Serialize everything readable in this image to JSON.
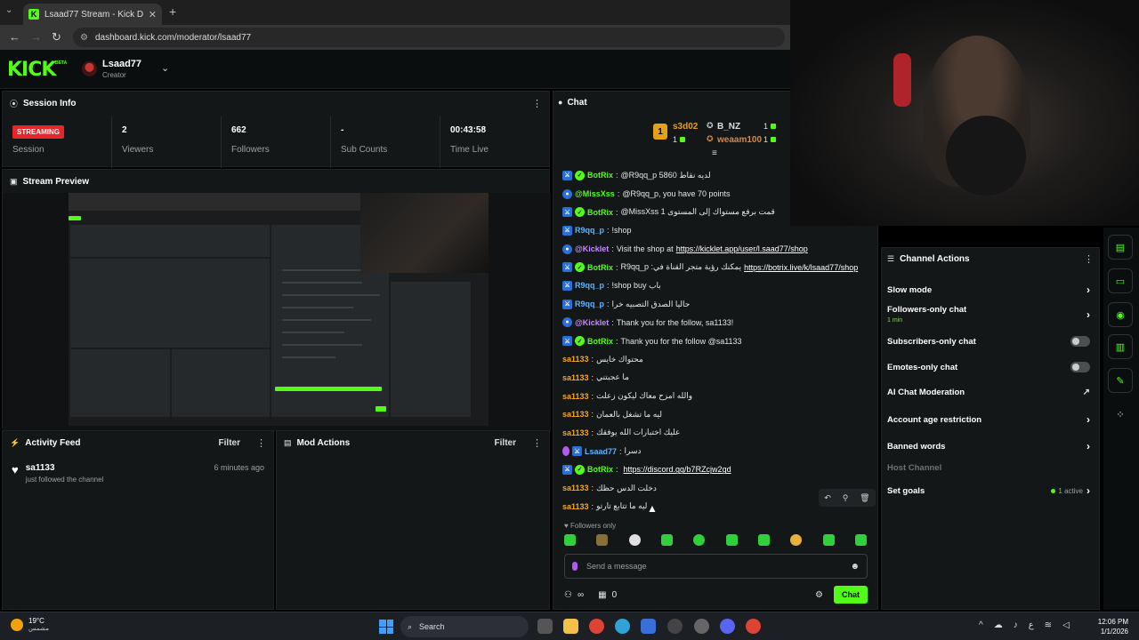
{
  "browser": {
    "tab_title": "Lsaad77 Stream - Kick Dashboard",
    "url": "dashboard.kick.com/moderator/lsaad77"
  },
  "header": {
    "logo": "KICK",
    "beta": "BETA",
    "channel_name": "Lsaad77",
    "channel_role": "Creator"
  },
  "session": {
    "title": "Session Info",
    "status_badge": "STREAMING",
    "session_label": "Session",
    "stats": [
      {
        "value": "2",
        "label": "Viewers"
      },
      {
        "value": "662",
        "label": "Followers"
      },
      {
        "value": "-",
        "label": "Sub Counts"
      },
      {
        "value": "00:43:58",
        "label": "Time Live"
      }
    ]
  },
  "preview": {
    "title": "Stream Preview"
  },
  "activity": {
    "title": "Activity Feed",
    "filter": "Filter",
    "items": [
      {
        "user": "sa1133",
        "desc": "just followed the channel",
        "time": "6 minutes ago"
      }
    ]
  },
  "mod_actions": {
    "title": "Mod Actions",
    "filter": "Filter"
  },
  "chat": {
    "title": "Chat",
    "leaderboard": [
      {
        "name": "s3d02",
        "count": "1"
      },
      {
        "name": "B_NZ",
        "count": "1"
      },
      {
        "name": "weaam100",
        "count": "1"
      }
    ],
    "leader_medal": "1",
    "messages": [
      {
        "badges": [
          "mod",
          "verified"
        ],
        "user": "BotRix",
        "color": "#53fc18",
        "text": "@R9qq_p 5860 لديه نقاط"
      },
      {
        "badges": [
          "bot"
        ],
        "user": "@MissXss",
        "color": "#53fc18",
        "text": "@R9qq_p, you have 70 points"
      },
      {
        "badges": [
          "mod",
          "verified"
        ],
        "user": "BotRix",
        "color": "#53fc18",
        "text": "@MissXss 1 قمت برفع مستواك إلى المستوى"
      },
      {
        "badges": [
          "mod"
        ],
        "user": "R9qq_p",
        "color": "#5ab4ff",
        "text": "!shop"
      },
      {
        "badges": [
          "bot"
        ],
        "user": "@Kicklet",
        "color": "#c48bff",
        "text": "Visit the shop at ",
        "link": "https://kicklet.app/user/l.saad77/shop"
      },
      {
        "badges": [
          "mod",
          "verified"
        ],
        "user": "BotRix",
        "color": "#53fc18",
        "text": "R9qq_p :يمكنك رؤية متجر القناة في ",
        "link": "https://botrix.live/k/lsaad77/shop"
      },
      {
        "badges": [
          "mod"
        ],
        "user": "R9qq_p",
        "color": "#5ab4ff",
        "text": "!shop buy باب"
      },
      {
        "badges": [
          "mod"
        ],
        "user": "R9qq_p",
        "color": "#5ab4ff",
        "text": "حاليا الصدق التصبيه خرا"
      },
      {
        "badges": [
          "bot"
        ],
        "user": "@Kicklet",
        "color": "#c48bff",
        "text": "Thank you for the follow, sa1133!"
      },
      {
        "badges": [
          "mod",
          "verified"
        ],
        "user": "BotRix",
        "color": "#53fc18",
        "text": "Thank you for the follow @sa1133"
      },
      {
        "badges": [],
        "user": "sa1133",
        "color": "#f5a623",
        "text": "محتواك خايس"
      },
      {
        "badges": [],
        "user": "sa1133",
        "color": "#f5a623",
        "text": "ما عجبتني"
      },
      {
        "badges": [],
        "user": "sa1133",
        "color": "#f5a623",
        "text": "والله امزح معاك ليكون زعلت"
      },
      {
        "badges": [],
        "user": "sa1133",
        "color": "#f5a623",
        "text": "ليه ما تشغل بالعمان"
      },
      {
        "badges": [],
        "user": "sa1133",
        "color": "#f5a623",
        "text": "عليك اختبارات الله يوفقك"
      },
      {
        "badges": [
          "broadcaster",
          "mod"
        ],
        "user": "Lsaad77",
        "color": "#5ab4ff",
        "text": "دسرا"
      },
      {
        "badges": [
          "mod",
          "verified"
        ],
        "user": "BotRix",
        "color": "#53fc18",
        "text": "",
        "link": "https://discord.gg/b7RZcjw2gd"
      },
      {
        "badges": [],
        "user": "sa1133",
        "color": "#f5a623",
        "text": "دخلت الدس حظك"
      },
      {
        "badges": [],
        "user": "sa1133",
        "color": "#f5a623",
        "text": "ليه ما تتابع تارتو"
      }
    ],
    "followers_only": "Followers only",
    "input_placeholder": "Send a message",
    "footer_infinity": "∞",
    "footer_count": "0",
    "send_label": "Chat"
  },
  "channel_actions": {
    "title": "Channel Actions",
    "items": [
      {
        "label": "Slow mode",
        "control": "chevron"
      },
      {
        "label": "Followers-only chat",
        "sub": "1 min",
        "control": "chevron"
      },
      {
        "label": "Subscribers-only chat",
        "control": "toggle"
      },
      {
        "label": "Emotes-only chat",
        "control": "toggle"
      },
      {
        "label": "AI Chat Moderation",
        "control": "external"
      },
      {
        "label": "Account age restriction",
        "control": "chevron"
      },
      {
        "label": "Banned words",
        "control": "chevron"
      },
      {
        "label": "Host Channel",
        "control": "disabled"
      },
      {
        "label": "Set goals",
        "control": "chevron",
        "active": "1 active"
      }
    ]
  },
  "taskbar": {
    "temp": "19°C",
    "weather": "مشمس",
    "search": "Search",
    "time": "12:06 PM",
    "date": "1/1/2026",
    "lang": "ع"
  },
  "colors": {
    "accent": "#53fc18",
    "panel": "#141718",
    "live": "#e5262b"
  }
}
